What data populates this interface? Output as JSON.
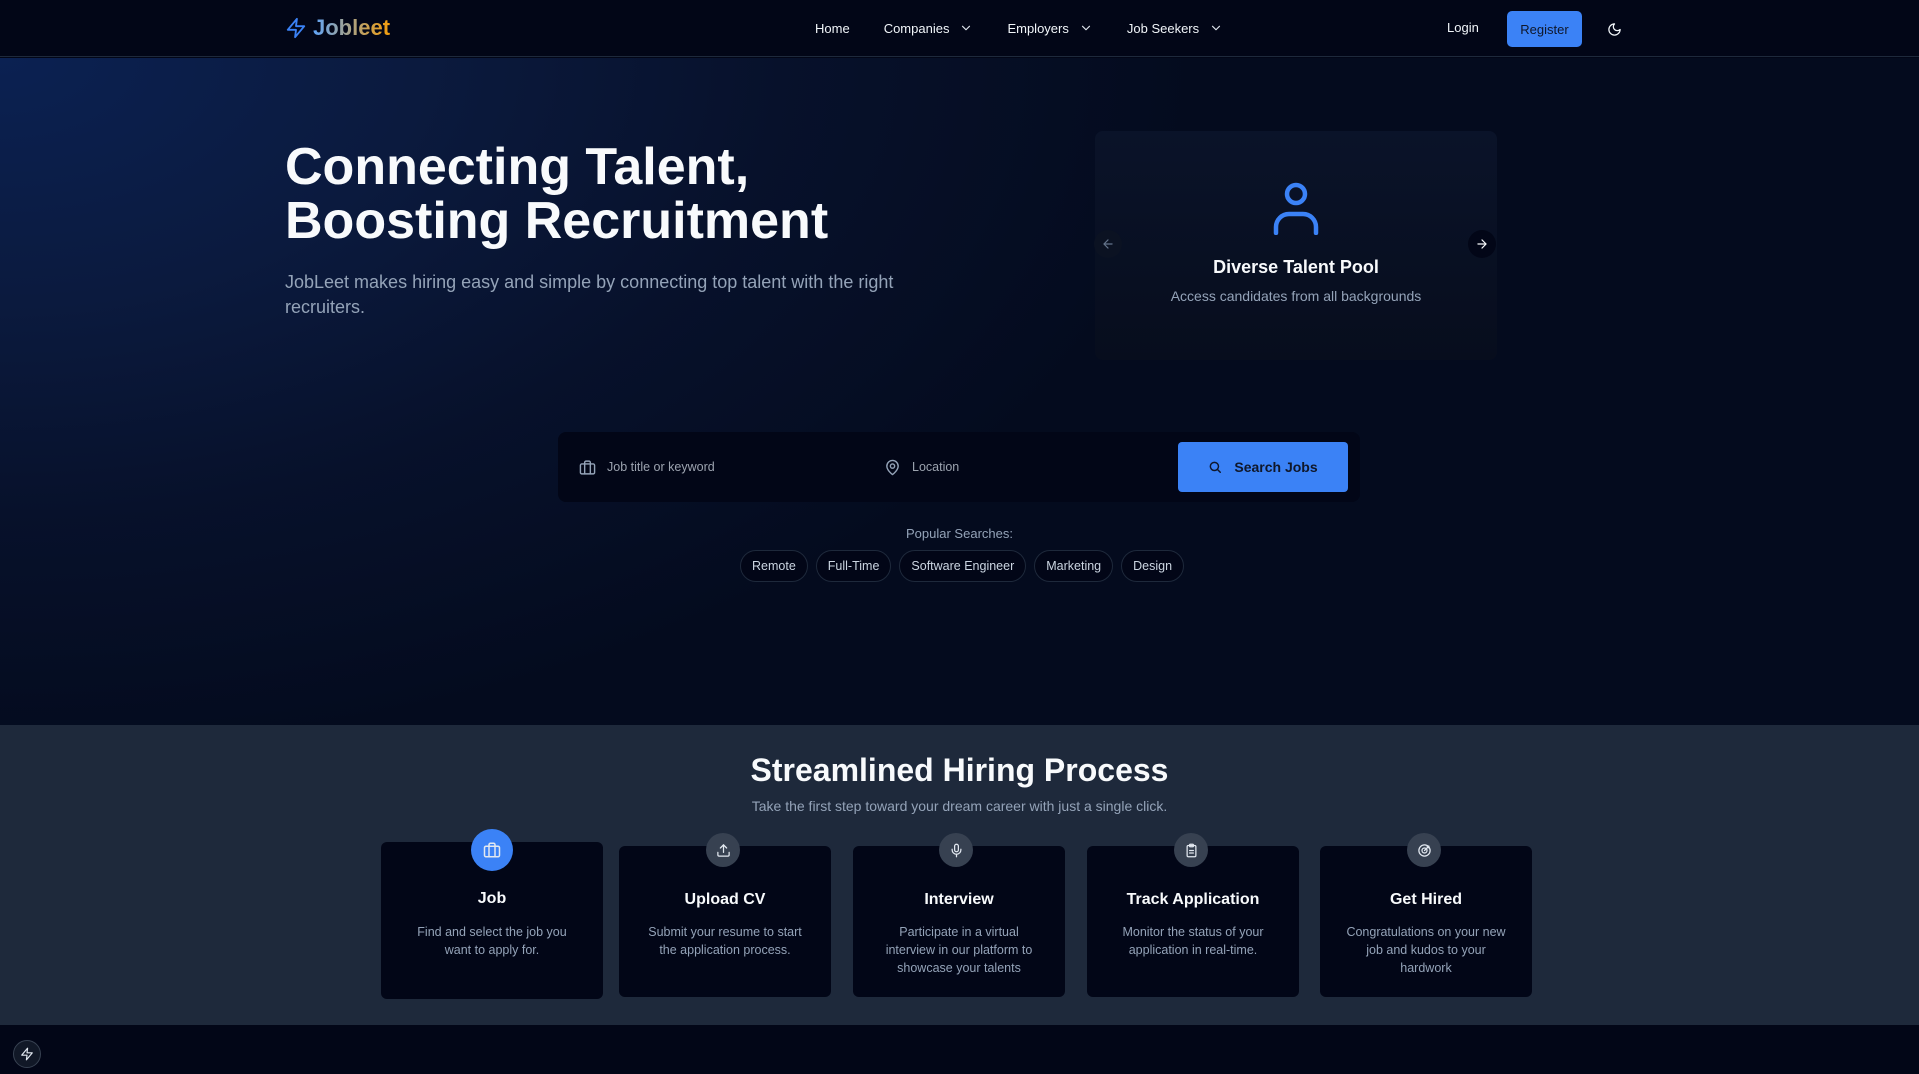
{
  "brand": {
    "name": "Jobleet",
    "icon": "lightning-bolt-icon",
    "gradient": [
      "#60a5fa",
      "#f59e0b"
    ]
  },
  "nav": {
    "links": [
      {
        "label": "Home",
        "dropdown": false
      },
      {
        "label": "Companies",
        "dropdown": true
      },
      {
        "label": "Employers",
        "dropdown": true
      },
      {
        "label": "Job Seekers",
        "dropdown": true
      }
    ],
    "login": "Login",
    "register": "Register",
    "theme_icon": "moon-icon"
  },
  "hero": {
    "title_line1": "Connecting Talent,",
    "title_line2": "Boosting Recruitment",
    "subtitle": "JobLeet makes hiring easy and simple by connecting top talent with the right recruiters."
  },
  "carousel": {
    "icon": "user-icon",
    "title": "Diverse Talent Pool",
    "description": "Access candidates from all backgrounds"
  },
  "search": {
    "job_placeholder": "Job title or keyword",
    "location_placeholder": "Location",
    "button": "Search Jobs",
    "popular_label": "Popular Searches:",
    "popular_tags": [
      "Remote",
      "Full-Time",
      "Software Engineer",
      "Marketing",
      "Design"
    ]
  },
  "process": {
    "title": "Streamlined Hiring Process",
    "subtitle": "Take the first step toward your dream career with just a single click.",
    "steps": [
      {
        "title": "Job",
        "description": "Find and select the job you want to apply for.",
        "icon": "briefcase-icon",
        "active": true
      },
      {
        "title": "Upload CV",
        "description": "Submit your resume to start the application process.",
        "icon": "upload-icon",
        "active": false
      },
      {
        "title": "Interview",
        "description": "Participate in a virtual interview in our platform to showcase your talents",
        "icon": "microphone-icon",
        "active": false
      },
      {
        "title": "Track Application",
        "description": "Monitor the status of your application in real-time.",
        "icon": "clipboard-icon",
        "active": false
      },
      {
        "title": "Get Hired",
        "description": "Congratulations on your new job and kudos to your hardwork",
        "icon": "target-icon",
        "active": false
      }
    ]
  },
  "colors": {
    "accent": "#3b82f6",
    "background": "#020617",
    "section": "#1e293b",
    "muted": "#94a3b8"
  }
}
